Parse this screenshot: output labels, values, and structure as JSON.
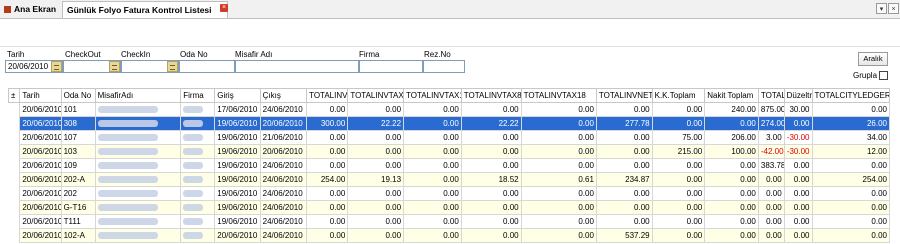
{
  "tabs": [
    {
      "label": "Ana Ekran"
    },
    {
      "label": "Günlük Folyo Fatura Kontrol Listesi"
    }
  ],
  "filters": {
    "tarih_label": "Tarih",
    "tarih_value": "20/06/2010",
    "checkout_label": "CheckOut",
    "checkout_value": "",
    "checkin_label": "CheckIn",
    "checkin_value": "",
    "odano_label": "Oda No",
    "odano_value": "",
    "misafir_label": "Misafir Adı",
    "misafir_value": "",
    "firma_label": "Firma",
    "firma_value": "",
    "rezno_label": "Rez.No",
    "rezno_value": "",
    "aralik_label": "Aralık",
    "grupla_label": "Grupla"
  },
  "grid": {
    "columns": [
      "Tarih",
      "Oda No",
      "MisafirAdı",
      "Firma",
      "Giriş",
      "Çıkış",
      "TOTALINV",
      "TOTALINVTAX",
      "TOTALINVTAX1",
      "TOTALINVTAX8",
      "TOTALINVTAX18",
      "TOTALINVNET",
      "K.K.Toplam",
      "Nakit Toplam",
      "TOTAL",
      "Düzeltm",
      "TOTALCITYLEDGER"
    ],
    "rows": [
      [
        "20/06/2010",
        "101",
        "",
        "",
        "17/06/2010",
        "24/06/2010",
        "0.00",
        "0.00",
        "0.00",
        "0.00",
        "0.00",
        "0.00",
        "0.00",
        "240.00",
        "875.00",
        "30.00",
        "0.00"
      ],
      [
        "20/06/2010",
        "308",
        "",
        "",
        "19/06/2010",
        "20/06/2010",
        "300.00",
        "22.22",
        "0.00",
        "22.22",
        "0.00",
        "277.78",
        "0.00",
        "0.00",
        "274.00",
        "0.00",
        "26.00"
      ],
      [
        "20/06/2010",
        "107",
        "",
        "",
        "19/06/2010",
        "21/06/2010",
        "0.00",
        "0.00",
        "0.00",
        "0.00",
        "0.00",
        "0.00",
        "75.00",
        "206.00",
        "3.00",
        "-30.00",
        "34.00"
      ],
      [
        "20/06/2010",
        "103",
        "",
        "",
        "19/06/2010",
        "20/06/2010",
        "0.00",
        "0.00",
        "0.00",
        "0.00",
        "0.00",
        "0.00",
        "215.00",
        "100.00",
        "-42.00",
        "-30.00",
        "12.00"
      ],
      [
        "20/06/2010",
        "109",
        "",
        "",
        "19/06/2010",
        "24/06/2010",
        "0.00",
        "0.00",
        "0.00",
        "0.00",
        "0.00",
        "0.00",
        "0.00",
        "0.00",
        "383.78",
        "0.00",
        "0.00"
      ],
      [
        "20/06/2010",
        "202-A",
        "",
        "",
        "19/06/2010",
        "24/06/2010",
        "254.00",
        "19.13",
        "0.00",
        "18.52",
        "0.61",
        "234.87",
        "0.00",
        "0.00",
        "0.00",
        "0.00",
        "254.00"
      ],
      [
        "20/06/2010",
        "202",
        "",
        "",
        "19/06/2010",
        "24/06/2010",
        "0.00",
        "0.00",
        "0.00",
        "0.00",
        "0.00",
        "0.00",
        "0.00",
        "0.00",
        "0.00",
        "0.00",
        "0.00"
      ],
      [
        "20/06/2010",
        "G-T16",
        "",
        "",
        "19/06/2010",
        "24/06/2010",
        "0.00",
        "0.00",
        "0.00",
        "0.00",
        "0.00",
        "0.00",
        "0.00",
        "0.00",
        "0.00",
        "0.00",
        "0.00"
      ],
      [
        "20/06/2010",
        "T111",
        "",
        "",
        "19/06/2010",
        "24/06/2010",
        "0.00",
        "0.00",
        "0.00",
        "0.00",
        "0.00",
        "0.00",
        "0.00",
        "0.00",
        "0.00",
        "0.00",
        "0.00"
      ],
      [
        "20/06/2010",
        "102-A",
        "",
        "",
        "20/06/2010",
        "24/06/2010",
        "0.00",
        "0.00",
        "0.00",
        "0.00",
        "0.00",
        "537.29",
        "0.00",
        "0.00",
        "0.00",
        "0.00",
        "0.00"
      ]
    ],
    "selected_row": 1
  },
  "colors": {
    "selection": "#2a6bd1",
    "negative": "#e00000",
    "alt_row": "#ffffe6"
  }
}
